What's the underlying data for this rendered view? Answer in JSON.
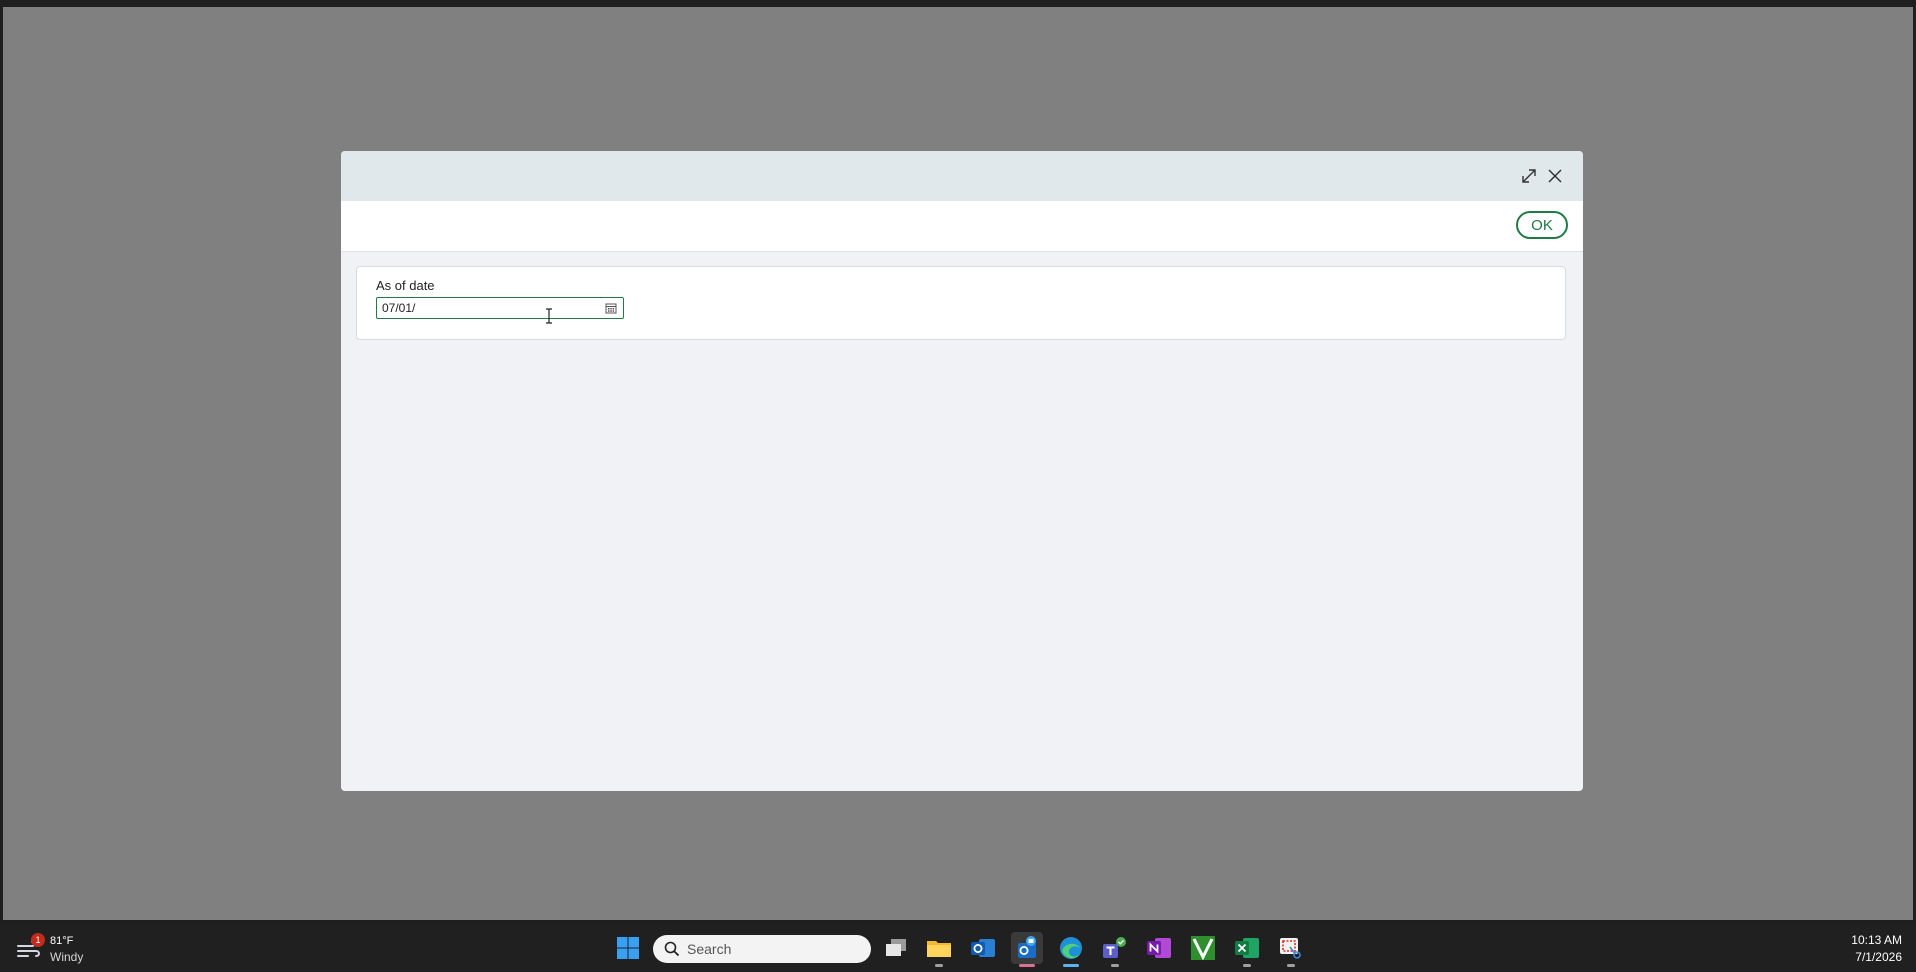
{
  "dialog": {
    "ok_label": "OK",
    "field": {
      "label": "As of date",
      "value": "07/01/"
    }
  },
  "taskbar": {
    "weather": {
      "badge": "1",
      "temp": "81°F",
      "condition": "Windy"
    },
    "search": {
      "placeholder": "Search"
    },
    "apps": [
      "start-icon",
      "task-view-icon",
      "file-explorer-icon",
      "outlook-icon",
      "outlook-new-icon",
      "edge-icon",
      "teams-icon",
      "onenote-icon",
      "vim-icon",
      "excel-icon",
      "snipping-tool-icon"
    ],
    "clock": {
      "time": "10:13 AM",
      "date": "7/1/2026"
    }
  },
  "colors": {
    "accent": "#1f7a45",
    "overlay": "#808080",
    "dialog_header": "#e1e8eb",
    "taskbar": "#202020"
  }
}
